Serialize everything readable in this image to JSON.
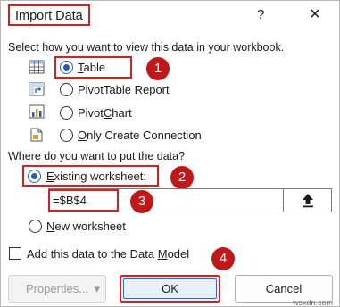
{
  "dialog": {
    "title": "Import Data",
    "help": "?",
    "close": "✕"
  },
  "view_section": {
    "prompt": "Select how you want to view this data in your workbook.",
    "options": [
      {
        "lead": "",
        "key": "T",
        "rest": "able",
        "selected": true,
        "icon": "table-icon"
      },
      {
        "lead": "",
        "key": "P",
        "rest": "ivotTable Report",
        "selected": false,
        "icon": "pivottable-icon"
      },
      {
        "lead": "Pivot",
        "key": "C",
        "rest": "hart",
        "selected": false,
        "icon": "pivotchart-icon"
      },
      {
        "lead": "",
        "key": "O",
        "rest": "nly Create Connection",
        "selected": false,
        "icon": "connection-icon"
      }
    ]
  },
  "location_section": {
    "prompt": "Where do you want to put the data?",
    "existing": {
      "lead": "",
      "key": "E",
      "rest": "xisting worksheet:",
      "selected": true
    },
    "range_value": "=$B$4",
    "new": {
      "lead": "",
      "key": "N",
      "rest": "ew worksheet",
      "selected": false
    }
  },
  "data_model": {
    "lead": "Add this data to the Data ",
    "key": "M",
    "rest": "odel",
    "checked": false
  },
  "buttons": {
    "properties": "Properties...",
    "properties_arrow": "▾",
    "ok": "OK",
    "cancel": "Cancel"
  },
  "annotations": [
    "1",
    "2",
    "3",
    "4"
  ],
  "watermark": "wsxdn.com",
  "colors": {
    "annotation": "#c01818",
    "highlight_border": "#d42020",
    "radio_selected": "#1f5fb0"
  }
}
